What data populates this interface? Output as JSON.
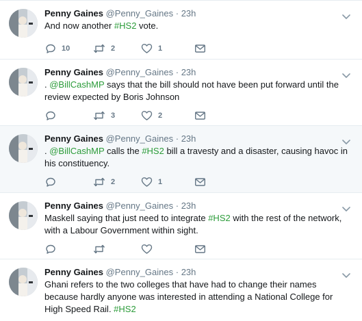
{
  "tweets": [
    {
      "author_name": "Penny Gaines",
      "author_handle": "@Penny_Gaines",
      "separator": "·",
      "time": "23h",
      "text_parts": [
        "And now another ",
        "#HS2",
        " vote."
      ],
      "replies": "10",
      "retweets": "2",
      "likes": "1",
      "highlighted": false
    },
    {
      "author_name": "Penny Gaines",
      "author_handle": "@Penny_Gaines",
      "separator": "·",
      "time": "23h",
      "text_parts": [
        ". ",
        "@BillCashMP",
        " says that the bill should not have been put forward until the review expected by Boris Johnson"
      ],
      "replies": "",
      "retweets": "3",
      "likes": "2",
      "highlighted": false
    },
    {
      "author_name": "Penny Gaines",
      "author_handle": "@Penny_Gaines",
      "separator": "·",
      "time": "23h",
      "text_parts": [
        ". ",
        "@BillCashMP",
        " calls the ",
        "#HS2",
        " bill a travesty and a disaster, causing havoc in his constituency."
      ],
      "replies": "",
      "retweets": "2",
      "likes": "1",
      "highlighted": true
    },
    {
      "author_name": "Penny Gaines",
      "author_handle": "@Penny_Gaines",
      "separator": "·",
      "time": "23h",
      "text_parts": [
        "Maskell saying that just need to integrate ",
        "#HS2",
        " with the rest of the network, with a Labour Government within sight."
      ],
      "replies": "",
      "retweets": "",
      "likes": "",
      "highlighted": false
    },
    {
      "author_name": "Penny Gaines",
      "author_handle": "@Penny_Gaines",
      "separator": "·",
      "time": "23h",
      "text_parts": [
        "Ghani refers to the two colleges that have had to change their names because hardly anyone was interested in attending a National College for High Speed Rail. ",
        "#HS2"
      ],
      "replies": "",
      "retweets": "",
      "likes": "",
      "highlighted": false
    }
  ],
  "icons": {
    "reply": "reply-icon",
    "retweet": "retweet-icon",
    "like": "heart-icon",
    "message": "envelope-icon",
    "caret": "chevron-down-icon"
  },
  "colors": {
    "link": "#2b9b39",
    "secondary_text": "#657786",
    "highlight_bg": "#f5f8fa",
    "border": "#e6ecf0"
  }
}
